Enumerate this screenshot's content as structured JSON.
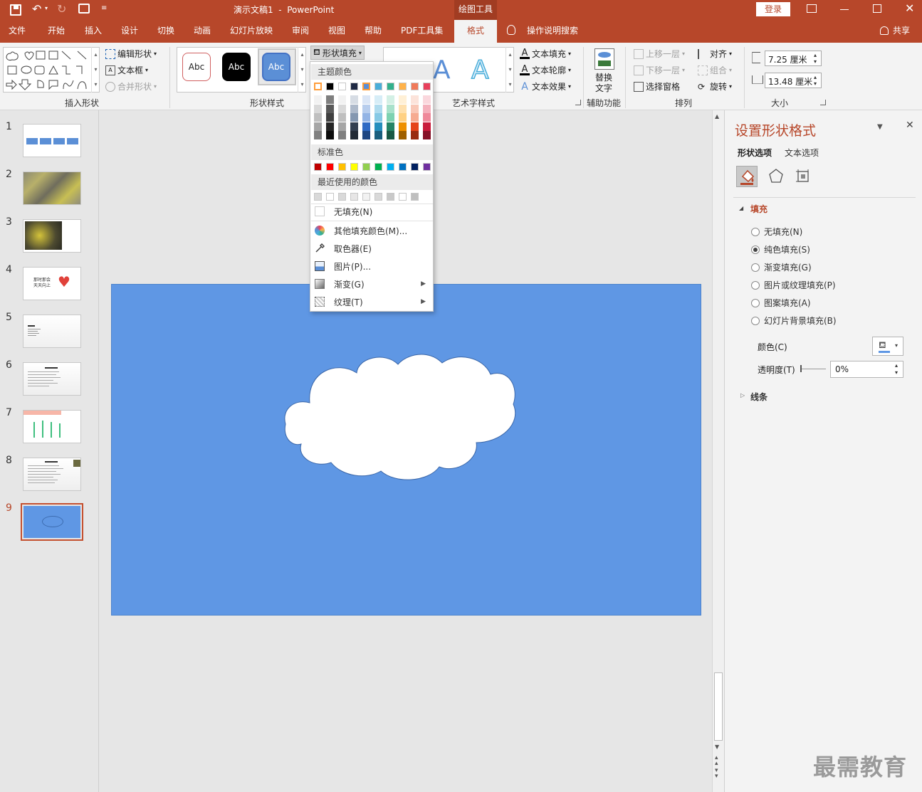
{
  "titlebar": {
    "title": "演示文稿1  -  PowerPoint",
    "context_tab": "绘图工具",
    "login": "登录"
  },
  "tabs": [
    "文件",
    "开始",
    "插入",
    "设计",
    "切换",
    "动画",
    "幻灯片放映",
    "审阅",
    "视图",
    "帮助",
    "PDF工具集",
    "格式"
  ],
  "active_tab": "格式",
  "tell_me": "操作说明搜索",
  "share": "共享",
  "ribbon": {
    "insert_shapes": {
      "label": "插入形状",
      "edit_shape": "编辑形状",
      "textbox": "文本框",
      "merge": "合并形状"
    },
    "shape_styles": {
      "label": "形状样式",
      "preset": "Abc",
      "shape_fill": "形状填充"
    },
    "wordart": {
      "label": "艺术字样式",
      "text_fill": "文本填充",
      "text_outline": "文本轮廓",
      "text_effects": "文本效果"
    },
    "accessibility": {
      "label": "辅助功能",
      "alt_text_1": "替换",
      "alt_text_2": "文字"
    },
    "arrange": {
      "label": "排列",
      "bring_forward": "上移一层",
      "send_backward": "下移一层",
      "selection_pane": "选择窗格",
      "align": "对齐",
      "group": "组合",
      "rotate": "旋转"
    },
    "size": {
      "label": "大小",
      "height": "7.25 厘米",
      "width": "13.48 厘米"
    }
  },
  "fill_dropdown": {
    "theme_header": "主题颜色",
    "standard_header": "标准色",
    "recent_header": "最近使用的颜色",
    "theme_top": [
      "#ffffff",
      "#000000",
      "#ffffff",
      "#1f2a44",
      "#5b8fd6",
      "#4aaed9",
      "#33b08c",
      "#ffb24a",
      "#f07a5a",
      "#e8405c"
    ],
    "theme_tints": [
      [
        "#f2f2f2",
        "#7f7f7f",
        "#f2f2f2",
        "#d6dce4",
        "#dbe6f6",
        "#d6edf7",
        "#d3f0e5",
        "#fff0d6",
        "#fce3da",
        "#fad7dd"
      ],
      [
        "#d9d9d9",
        "#595959",
        "#d9d9d9",
        "#adb9ca",
        "#b7cded",
        "#aedbee",
        "#a8e1cb",
        "#ffe0ad",
        "#f9c7b6",
        "#f4b0bc"
      ],
      [
        "#bfbfbf",
        "#3f3f3f",
        "#bfbfbf",
        "#8497b0",
        "#93b4e5",
        "#86c9e5",
        "#7dd2b1",
        "#ffd184",
        "#f6ab91",
        "#ef889a"
      ],
      [
        "#a6a6a6",
        "#262626",
        "#a6a6a6",
        "#333f50",
        "#2f6ac4",
        "#268fbd",
        "#248466",
        "#ee9000",
        "#e5441a",
        "#c91a3a"
      ],
      [
        "#808080",
        "#0d0d0d",
        "#808080",
        "#222a35",
        "#1f4783",
        "#1a5f7e",
        "#185844",
        "#9f6000",
        "#992d11",
        "#861227"
      ]
    ],
    "standard": [
      "#c00000",
      "#ff0000",
      "#ffc000",
      "#ffff00",
      "#92d050",
      "#00b050",
      "#00b0f0",
      "#0070c0",
      "#002060",
      "#7030a0"
    ],
    "recent": [
      "#d9d9d9",
      "#ffffff",
      "#d9d9d9",
      "#e7e6e6",
      "#f2f2f2",
      "#d9d9d9",
      "#c9c9c9",
      "#ffffff",
      "#bfbfbf"
    ],
    "no_fill": "无填充(N)",
    "more_colors": "其他填充颜色(M)...",
    "eyedropper": "取色器(E)",
    "picture": "图片(P)...",
    "gradient": "渐变(G)",
    "texture": "纹理(T)"
  },
  "slides": [
    "1",
    "2",
    "3",
    "4",
    "5",
    "6",
    "7",
    "8",
    "9"
  ],
  "slide4_text": "那时那会\n天天向上",
  "selected_slide": "9",
  "format_pane": {
    "title": "设置形状格式",
    "tab_shape": "形状选项",
    "tab_text": "文本选项",
    "fill_section": "填充",
    "options": [
      "无填充(N)",
      "纯色填充(S)",
      "渐变填充(G)",
      "图片或纹理填充(P)",
      "图案填充(A)",
      "幻灯片背景填充(B)"
    ],
    "selected_option": "纯色填充(S)",
    "color_label": "颜色(C)",
    "transparency_label": "透明度(T)",
    "transparency_value": "0%",
    "line_section": "线条"
  },
  "watermark": "最需教育",
  "colors": {
    "accent": "#b7472a",
    "slide_bg": "#5f97e4",
    "cloud": "#ffffff"
  }
}
